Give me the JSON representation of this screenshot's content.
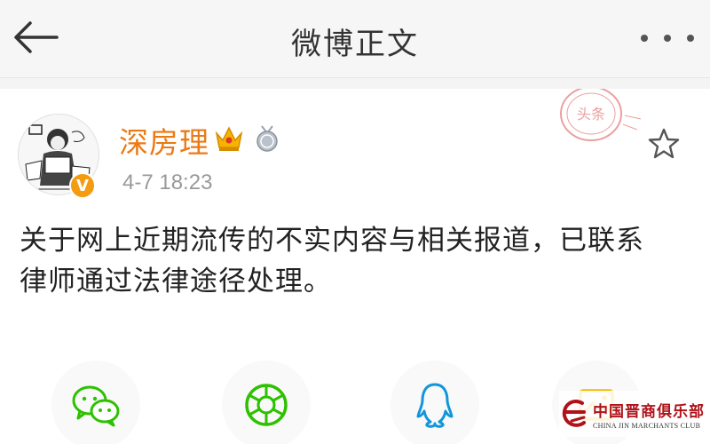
{
  "header": {
    "title": "微博正文",
    "back_icon": "back-arrow-icon",
    "more_icon": "more-dots-icon"
  },
  "post": {
    "author": "深房理",
    "timestamp": "4-7 18:23",
    "verified_badge": "V",
    "text_line1": "关于网上近期流传的不实内容与相关报道，已联系",
    "text_line2": "律师通过法律途径处理。",
    "badges": [
      "crown-icon",
      "medal-icon"
    ],
    "stamp_text": "头条",
    "favorite_icon": "star-icon"
  },
  "share": {
    "items": [
      "wechat-icon",
      "moments-icon",
      "qq-icon",
      "qzone-icon"
    ]
  },
  "watermark": {
    "cn": "中国晋商俱乐部",
    "en": "CHINA JIN MARCHANTS CLUB"
  },
  "colors": {
    "accent": "#eb7a14",
    "wechat": "#2dc100",
    "qq": "#1296db",
    "qzone": "#f5b800"
  }
}
